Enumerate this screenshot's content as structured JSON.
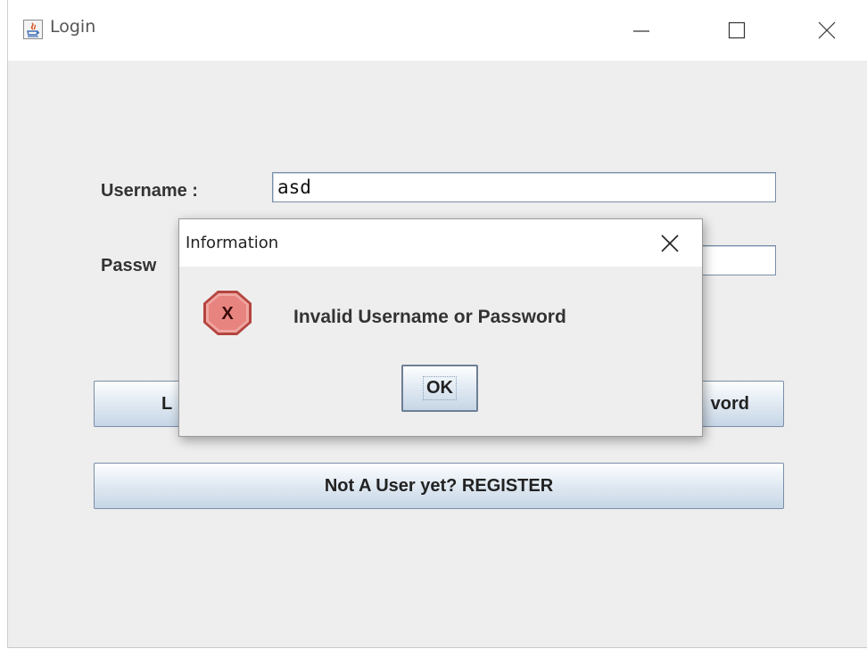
{
  "window": {
    "title": "Login",
    "controls": {
      "minimize": "minimize",
      "maximize": "maximize",
      "close": "close"
    }
  },
  "form": {
    "username_label": "Username :",
    "username_value": "asd",
    "password_label": "Passw",
    "password_value": ""
  },
  "buttons": {
    "login_partial": "L",
    "forgot_partial": "vord",
    "register": "Not A User yet? REGISTER"
  },
  "dialog": {
    "title": "Information",
    "message": "Invalid Username or Password",
    "ok_label": "OK",
    "icon": "error-icon"
  },
  "colors": {
    "error_red": "#e0514c",
    "button_border": "#7a8ea8"
  }
}
